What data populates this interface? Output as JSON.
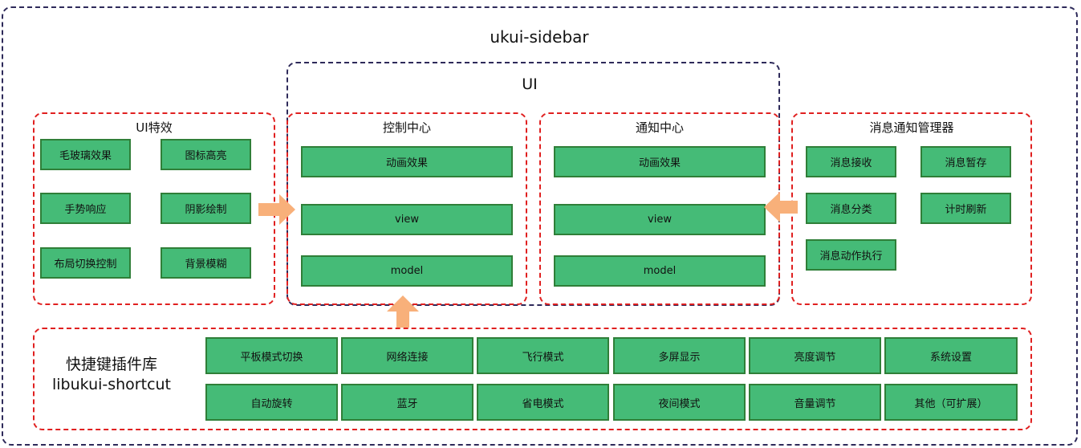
{
  "outer": {
    "title": "ukui-sidebar"
  },
  "ui_frame": {
    "title": "UI"
  },
  "effects": {
    "title": "UI特效",
    "items": [
      "毛玻璃效果",
      "图标高亮",
      "手势响应",
      "阴影绘制",
      "布局切换控制",
      "背景模糊"
    ]
  },
  "control_center": {
    "title": "控制中心",
    "items": [
      "动画效果",
      "view",
      "model"
    ]
  },
  "notify_center": {
    "title": "通知中心",
    "items": [
      "动画效果",
      "view",
      "model"
    ]
  },
  "msg_manager": {
    "title": "消息通知管理器",
    "items": [
      "消息接收",
      "消息暂存",
      "消息分类",
      "计时刷新",
      "消息动作执行"
    ]
  },
  "shortcut": {
    "title_cn": "快捷键插件库",
    "title_en": "libukui-shortcut",
    "row1": [
      "平板模式切换",
      "网络连接",
      "飞行模式",
      "多屏显示",
      "亮度调节",
      "系统设置"
    ],
    "row2": [
      "自动旋转",
      "蓝牙",
      "省电模式",
      "夜间模式",
      "音量调节",
      "其他（可扩展）"
    ]
  },
  "colors": {
    "box_fill": "#45bb77",
    "box_border": "#2f7f38",
    "arrow": "#f8b07a",
    "red_dash": "#e02020",
    "navy_dash": "#2e2a5a"
  }
}
